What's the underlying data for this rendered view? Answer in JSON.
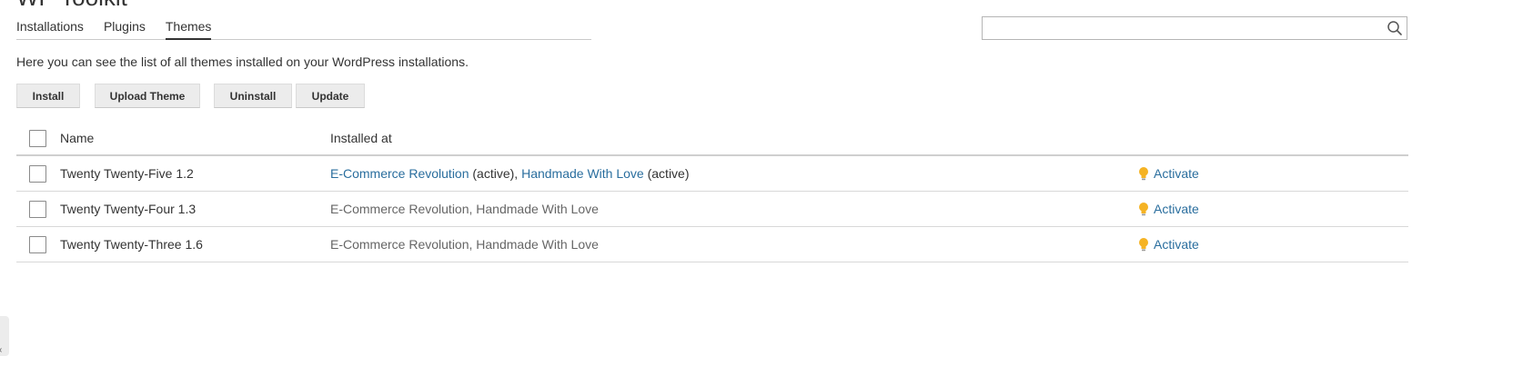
{
  "page": {
    "title": "WP Toolkit"
  },
  "tabs": [
    {
      "label": "Installations",
      "active": false
    },
    {
      "label": "Plugins",
      "active": false
    },
    {
      "label": "Themes",
      "active": true
    }
  ],
  "search": {
    "value": "",
    "placeholder": "",
    "icon": "search-icon"
  },
  "intro": "Here you can see the list of all themes installed on your WordPress installations.",
  "toolbar": {
    "install_label": "Install",
    "upload_label": "Upload Theme",
    "uninstall_label": "Uninstall",
    "update_label": "Update"
  },
  "table": {
    "columns": {
      "name": "Name",
      "installed_at": "Installed at"
    },
    "rows": [
      {
        "name": "Twenty Twenty-Five 1.2",
        "site1": "E-Commerce Revolution",
        "site1_status": " (active)",
        "sep": ", ",
        "site2": "Handmade With Love",
        "site2_status": " (active)",
        "action": "Activate"
      },
      {
        "name": "Twenty Twenty-Four 1.3",
        "site1": "E-Commerce Revolution",
        "site1_status": "",
        "sep": ", ",
        "site2": "Handmade With Love",
        "site2_status": "",
        "action": "Activate"
      },
      {
        "name": "Twenty Twenty-Three 1.6",
        "site1": "E-Commerce Revolution",
        "site1_status": "",
        "sep": ", ",
        "site2": "Handmade With Love",
        "site2_status": "",
        "action": "Activate"
      }
    ]
  },
  "colors": {
    "link": "#2a6e9e",
    "bulb": "#f5b324",
    "muted_text": "#666666"
  },
  "side_handle": {
    "icon": "chevron-left-icon",
    "glyph": "‹"
  }
}
